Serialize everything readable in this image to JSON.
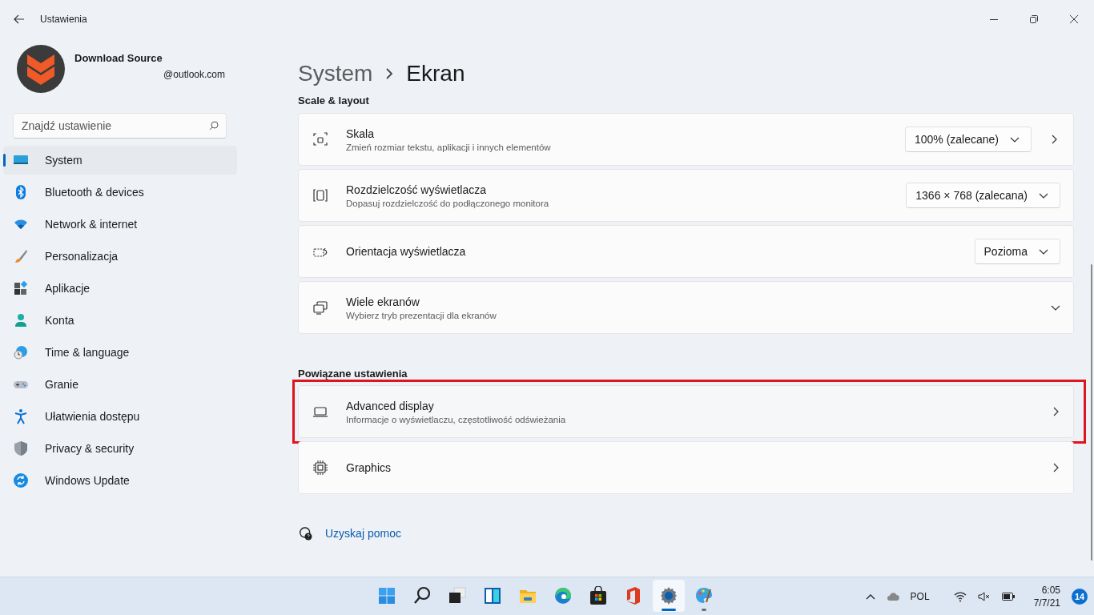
{
  "window": {
    "title": "Ustawienia"
  },
  "account": {
    "name": "Download Source",
    "email": "@outlook.com"
  },
  "search": {
    "placeholder": "Znajdź ustawienie"
  },
  "sidebar": {
    "items": [
      {
        "label": "System",
        "selected": true
      },
      {
        "label": "Bluetooth & devices",
        "selected": false
      },
      {
        "label": "Network & internet",
        "selected": false
      },
      {
        "label": "Personalizacja",
        "selected": false
      },
      {
        "label": "Aplikacje",
        "selected": false
      },
      {
        "label": "Konta",
        "selected": false
      },
      {
        "label": "Time & language",
        "selected": false
      },
      {
        "label": "Granie",
        "selected": false
      },
      {
        "label": "Ułatwienia dostępu",
        "selected": false
      },
      {
        "label": "Privacy & security",
        "selected": false
      },
      {
        "label": "Windows Update",
        "selected": false
      }
    ]
  },
  "breadcrumb": {
    "parent": "System",
    "current": "Ekran"
  },
  "sections": [
    {
      "heading": "Scale & layout",
      "rows": [
        {
          "kind": "dropdown",
          "title": "Skala",
          "subtitle": "Zmień rozmiar tekstu, aplikacji i innych elementów",
          "value": "100% (zalecane)",
          "navigable": true,
          "highlighted": false
        },
        {
          "kind": "dropdown",
          "title": "Rozdzielczość wyświetlacza",
          "subtitle": "Dopasuj rozdzielczość do podłączonego monitora",
          "value": "1366 × 768 (zalecana)",
          "navigable": false,
          "highlighted": false
        },
        {
          "kind": "dropdown",
          "title": "Orientacja wyświetlacza",
          "value": "Pozioma",
          "navigable": false,
          "highlighted": false
        },
        {
          "kind": "expander",
          "title": "Wiele ekranów",
          "subtitle": "Wybierz tryb prezentacji dla ekranów",
          "expanded": false,
          "highlighted": false
        }
      ]
    },
    {
      "heading": "Powiązane ustawienia",
      "rows": [
        {
          "kind": "link",
          "title": "Advanced display",
          "subtitle": "Informacje o wyświetlaczu, częstotliwość odświeżania",
          "highlighted": true
        },
        {
          "kind": "link",
          "title": "Graphics",
          "highlighted": false
        }
      ]
    }
  ],
  "help": {
    "label": "Uzyskaj pomoc"
  },
  "taskbar": {
    "apps": [
      {
        "selected": false,
        "running": false
      },
      {
        "selected": false,
        "running": false
      },
      {
        "selected": false,
        "running": false
      },
      {
        "selected": false,
        "running": false
      },
      {
        "selected": false,
        "running": false
      },
      {
        "selected": false,
        "running": false
      },
      {
        "selected": false,
        "running": false
      },
      {
        "selected": false,
        "running": false
      },
      {
        "selected": true,
        "running": true
      },
      {
        "selected": false,
        "running": true
      }
    ]
  },
  "tray": {
    "language": "POL",
    "time": "6:05",
    "date": "7/7/21",
    "notifications": "14"
  }
}
